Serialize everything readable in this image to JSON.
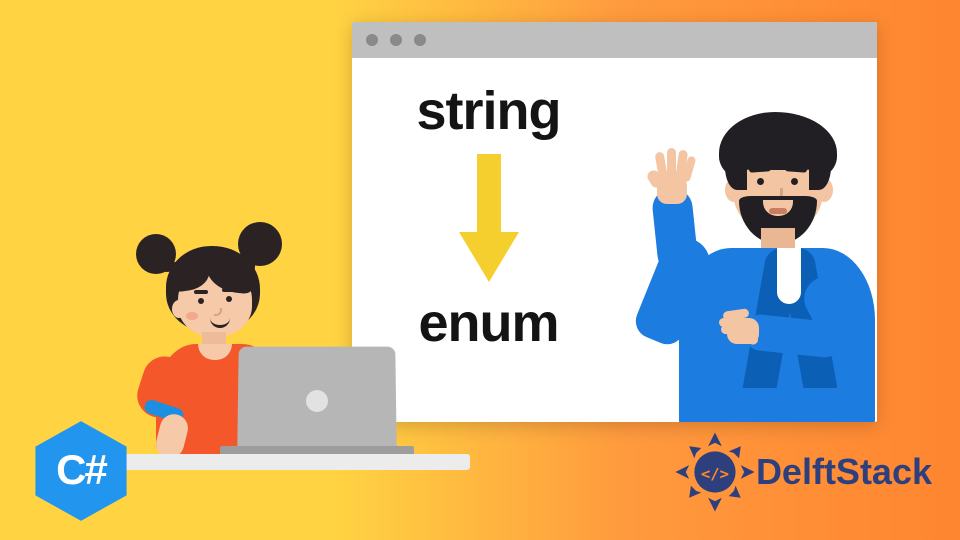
{
  "browser": {
    "keyword_top": "string",
    "keyword_bottom": "enum"
  },
  "badges": {
    "csharp": "C#",
    "brand": "DelftStack"
  },
  "icons": {
    "arrow": "down-arrow-icon",
    "window_dots": "window-traffic-lights"
  },
  "colors": {
    "grad_left": "#FFD342",
    "grad_right": "#FF8530",
    "csharp": "#2296EE",
    "delft_blue": "#2E3F7E",
    "arrow": "#F5CF2E",
    "shirt_orange": "#F4572A",
    "jacket_blue": "#1C7CE0"
  }
}
